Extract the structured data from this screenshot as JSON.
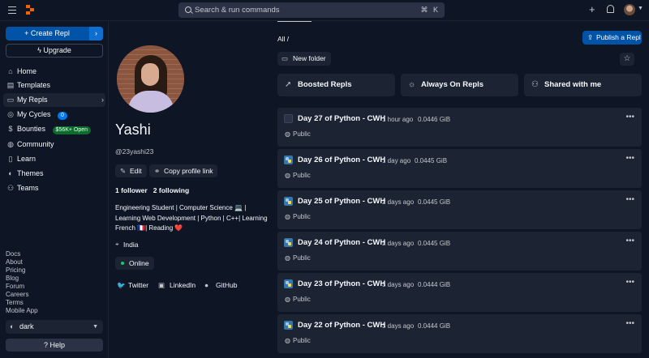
{
  "topbar": {
    "search_placeholder": "Search & run commands",
    "search_shortcut": "⌘ K"
  },
  "sidebar": {
    "create_label": "Create Repl",
    "upgrade_label": "Upgrade",
    "items": [
      {
        "label": "Home",
        "icon": "home-icon",
        "glyph": "⌂"
      },
      {
        "label": "Templates",
        "icon": "templates-icon",
        "glyph": "▤"
      },
      {
        "label": "My Repls",
        "icon": "folder-icon",
        "glyph": "▭"
      },
      {
        "label": "My Cycles",
        "icon": "cycles-icon",
        "glyph": "◎",
        "badge": "0"
      },
      {
        "label": "Bounties",
        "icon": "dollar-icon",
        "glyph": "$",
        "badge": "$56K+ Open"
      },
      {
        "label": "Community",
        "icon": "globe-icon",
        "glyph": "◍"
      },
      {
        "label": "Learn",
        "icon": "book-icon",
        "glyph": "▯"
      },
      {
        "label": "Themes",
        "icon": "palette-icon",
        "glyph": "◐"
      },
      {
        "label": "Teams",
        "icon": "people-icon",
        "glyph": "⚇"
      }
    ],
    "footer_links": [
      "Docs",
      "About",
      "Pricing",
      "Blog",
      "Forum",
      "Careers",
      "Terms",
      "Mobile App"
    ],
    "theme_value": "dark",
    "help_label": "Help"
  },
  "profile": {
    "name": "Yashi",
    "handle": "@23yashi23",
    "edit_label": "Edit",
    "copy_label": "Copy profile link",
    "followers": "1 follower",
    "following": "2 following",
    "bio": "Engineering Student | Computer Science 💻 | Learning Web Development | Python | C++| Learning French 🇫🇷| Reading ❤️",
    "location": "India",
    "status": "Online",
    "social": {
      "twitter": "Twitter",
      "linkedin": "LinkedIn",
      "github": "GitHub"
    }
  },
  "main": {
    "breadcrumb": "All /",
    "publish_label": "Publish a Repl",
    "new_folder_label": "New folder",
    "categories": [
      "Boosted Repls",
      "Always On Repls",
      "Shared with me"
    ],
    "repls": [
      {
        "title": "Day 27 of Python - CWH",
        "time": "1 hour ago",
        "size": "0.0446 GiB",
        "visibility": "Public",
        "icon": "empty"
      },
      {
        "title": "Day 26 of Python - CWH",
        "time": "1 day ago",
        "size": "0.0445 GiB",
        "visibility": "Public",
        "icon": "python"
      },
      {
        "title": "Day 25 of Python - CWH",
        "time": "2 days ago",
        "size": "0.0445 GiB",
        "visibility": "Public",
        "icon": "python"
      },
      {
        "title": "Day 24 of Python - CWH",
        "time": "2 days ago",
        "size": "0.0445 GiB",
        "visibility": "Public",
        "icon": "python"
      },
      {
        "title": "Day 23 of Python - CWH",
        "time": "3 days ago",
        "size": "0.0444 GiB",
        "visibility": "Public",
        "icon": "python"
      },
      {
        "title": "Day 22 of Python - CWH",
        "time": "3 days ago",
        "size": "0.0444 GiB",
        "visibility": "Public",
        "icon": "python"
      }
    ]
  },
  "colors": {
    "background": "#0e1525",
    "surface": "#1c2333",
    "accent": "#0053a6",
    "brand": "#f26207"
  }
}
